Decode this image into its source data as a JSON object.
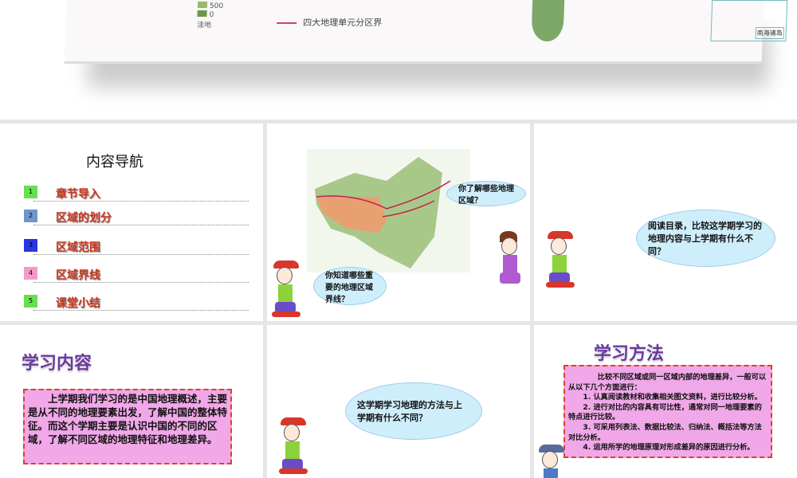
{
  "top_slide": {
    "legend_values": [
      "500",
      "0"
    ],
    "legend_lowland": "洼地",
    "border_legend": "四大地理单元分区界",
    "nanhai_label": "南海诸岛"
  },
  "nav_slide": {
    "title": "内容导航",
    "items": [
      {
        "num": "1",
        "label": "章节导入",
        "color": "#66e050"
      },
      {
        "num": "2",
        "label": "区域的划分",
        "color": "#6e96c8"
      },
      {
        "num": "3",
        "label": "区域范围",
        "color": "#2a36e0"
      },
      {
        "num": "4",
        "label": "区域界线",
        "color": "#f49ac8"
      },
      {
        "num": "5",
        "label": "课堂小结",
        "color": "#66e050"
      }
    ]
  },
  "map_slide": {
    "cloud_right": "你了解哪些地理区域？",
    "cloud_left": "你知道哪些重要的地理区域界线？"
  },
  "question_slide": {
    "cloud": "阅读目录，比较这学期学习的地理内容与上学期有什么不同？"
  },
  "content_slide": {
    "title": "学习内容",
    "text": "上学期我们学习的是中国地理概述，主要是从不同的地理要素出发，了解中国的整体特征。而这个学期主要是认识中国的不同的区域，了解不同区域的地理特征和地理差异。"
  },
  "method_question_slide": {
    "cloud": "这学期学习地理的方法与上学期有什么不同？"
  },
  "method_slide": {
    "title": "学习方法",
    "intro": "比较不同区域或同一区域内部的地理差异，一般可以从以下几个方面进行：",
    "points": [
      "1. 认真阅读教材和收集相关图文资料，进行比较分析。",
      "2. 进行对比的内容具有可比性，通常对同一地理要素的特点进行比较。",
      "3. 可采用列表法、数据比较法、归纳法、概括法等方法对比分析。",
      "4. 运用所学的地理原理对形成差异的原因进行分析。"
    ]
  }
}
